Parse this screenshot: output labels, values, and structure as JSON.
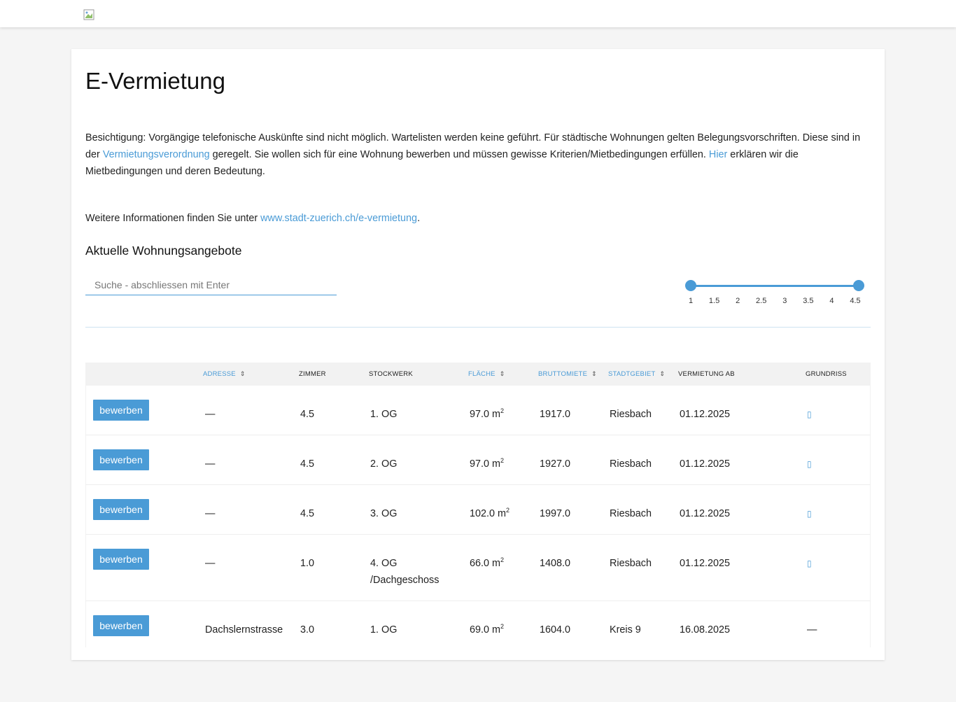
{
  "header": {
    "logo_icon": "broken-image-icon"
  },
  "page": {
    "title": "E-Vermietung",
    "intro": {
      "part1": "Besichtigung: Vorgängige telefonische Auskünfte sind nicht möglich. Wartelisten werden keine geführt. Für städtische Wohnungen gelten Belegungsvorschriften. Diese sind in der ",
      "link1": "Vermietungsverordnung",
      "part2": " geregelt. Sie wollen sich für eine Wohnung bewerben und müssen gewisse Kriterien/Mietbedingungen erfüllen. ",
      "link2": "Hier",
      "part3": " erklären wir die Mietbedingungen und deren Bedeutung."
    },
    "more": {
      "prefix": "Weitere Informationen finden Sie unter ",
      "link": "www.stadt-zuerich.ch/e-vermietung",
      "suffix": "."
    },
    "section_title": "Aktuelle Wohnungsangebote",
    "search": {
      "placeholder": "Suche - abschliessen mit Enter",
      "value": ""
    },
    "rooms_slider": {
      "ticks": [
        "1",
        "1.5",
        "2",
        "2.5",
        "3",
        "3.5",
        "4",
        "4.5"
      ],
      "min": 1,
      "max": 4.5,
      "selected_min": 1,
      "selected_max": 4.5
    },
    "accent_color": "#4a9bd6"
  },
  "table": {
    "headers": {
      "adresse": "Adresse",
      "zimmer": "Zimmer",
      "stockwerk": "Stockwerk",
      "flaeche": "Fläche",
      "bruttomiete": "Bruttomiete",
      "stadtgebiet": "Stadtgebiet",
      "vermietung_ab": "Vermietung ab",
      "grundriss": "Grundriss"
    },
    "sort_icon": "sort-icon",
    "apply_label": "bewerben",
    "area_unit": "m",
    "area_unit_sup": "2",
    "rows": [
      {
        "adresse": "—",
        "zimmer": "4.5",
        "stockwerk": "1. OG",
        "flaeche": "97.0",
        "miete": "1917.0",
        "gebiet": "Riesbach",
        "ab": "01.12.2025",
        "grundriss": "floorplan-icon"
      },
      {
        "adresse": "—",
        "zimmer": "4.5",
        "stockwerk": "2. OG",
        "flaeche": "97.0",
        "miete": "1927.0",
        "gebiet": "Riesbach",
        "ab": "01.12.2025",
        "grundriss": "floorplan-icon"
      },
      {
        "adresse": "—",
        "zimmer": "4.5",
        "stockwerk": "3. OG",
        "flaeche": "102.0",
        "miete": "1997.0",
        "gebiet": "Riesbach",
        "ab": "01.12.2025",
        "grundriss": "floorplan-icon"
      },
      {
        "adresse": "—",
        "zimmer": "1.0",
        "stockwerk": "4. OG /Dachgeschoss",
        "flaeche": "66.0",
        "miete": "1408.0",
        "gebiet": "Riesbach",
        "ab": "01.12.2025",
        "grundriss": "floorplan-icon"
      },
      {
        "adresse": "Dachslernstrasse",
        "zimmer": "3.0",
        "stockwerk": "1. OG",
        "flaeche": "69.0",
        "miete": "1604.0",
        "gebiet": "Kreis 9",
        "ab": "16.08.2025",
        "grundriss_text": "—"
      }
    ]
  }
}
